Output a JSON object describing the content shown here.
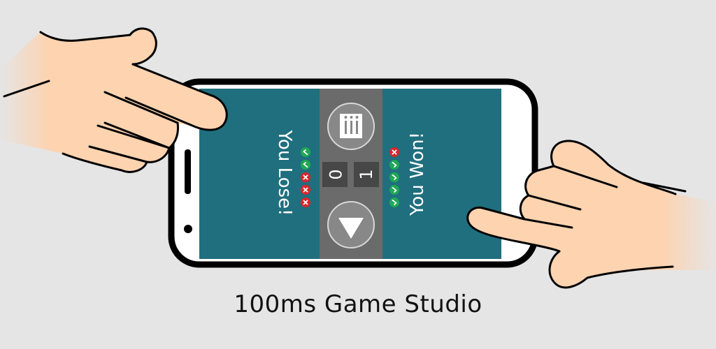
{
  "studio": {
    "name": "100ms Game Studio"
  },
  "left_player": {
    "result": "You Lose!",
    "round_marks": [
      "check",
      "check",
      "cross",
      "cross",
      "cross"
    ],
    "score": "0"
  },
  "right_player": {
    "result": "You Won!",
    "round_marks": [
      "cross",
      "check",
      "check",
      "check",
      "check"
    ],
    "score": "1"
  },
  "center_panel": {
    "menu_icon": "stats-bars-icon",
    "play_icon": "down-triangle-icon"
  },
  "colors": {
    "background": "#e5e5e5",
    "panel_teal": "#206f7e",
    "center_gray": "#6b6b6b",
    "check_green": "#1fa855",
    "cross_red": "#d9262c",
    "skin": "#fdd3b0"
  }
}
